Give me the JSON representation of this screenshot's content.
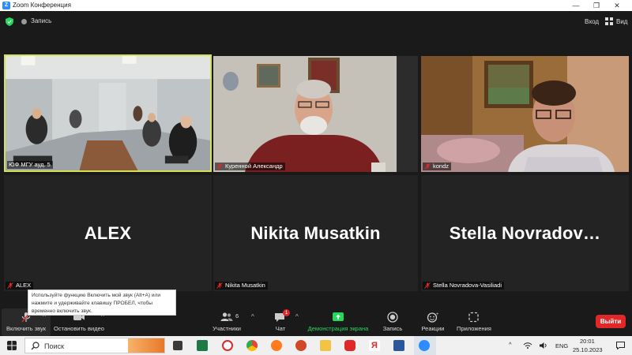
{
  "window": {
    "title": "Zoom Конференция",
    "logo_letter": "Z"
  },
  "topbar": {
    "record_label": "Запись",
    "exit_label": "Вход",
    "view_label": "Вид"
  },
  "tiles": [
    {
      "name": "ЮФ МГУ ауд. 5",
      "type": "video",
      "active_speaker": true
    },
    {
      "name": "Куренной Александр",
      "type": "video"
    },
    {
      "name": "kondz",
      "type": "video"
    },
    {
      "name": "ALEX",
      "display_name": "ALEX",
      "type": "avatar"
    },
    {
      "name": "Nikita Musatkin",
      "display_name": "Nikita Musatkin",
      "type": "avatar"
    },
    {
      "name": "Stella Novradova-Vasiliadi",
      "display_name": "Stella  Novradov…",
      "type": "avatar"
    }
  ],
  "tooltip": {
    "text": "Используйте функцию Включить мой звук (Alt+A) или нажмите и удерживайте клавишу ПРОБЕЛ, чтобы временно включить звук."
  },
  "toolbar": {
    "unmute_label": "Включить звук",
    "start_video_label": "Остановить видео",
    "participants_label": "Участники",
    "participants_count": "6",
    "chat_label": "Чат",
    "chat_badge": "1",
    "share_label": "Демонстрация экрана",
    "record_label": "Запись",
    "reactions_label": "Реакции",
    "apps_label": "Приложения",
    "leave_label": "Выйти"
  },
  "taskbar": {
    "search_placeholder": "Поиск",
    "language": "ENG",
    "time": "20:01",
    "date": "25.10.2023"
  },
  "colors": {
    "accent": "#2d8cff",
    "active_speaker_border": "#d4e157",
    "muted_red": "#e02828",
    "share_green": "#23d959"
  }
}
